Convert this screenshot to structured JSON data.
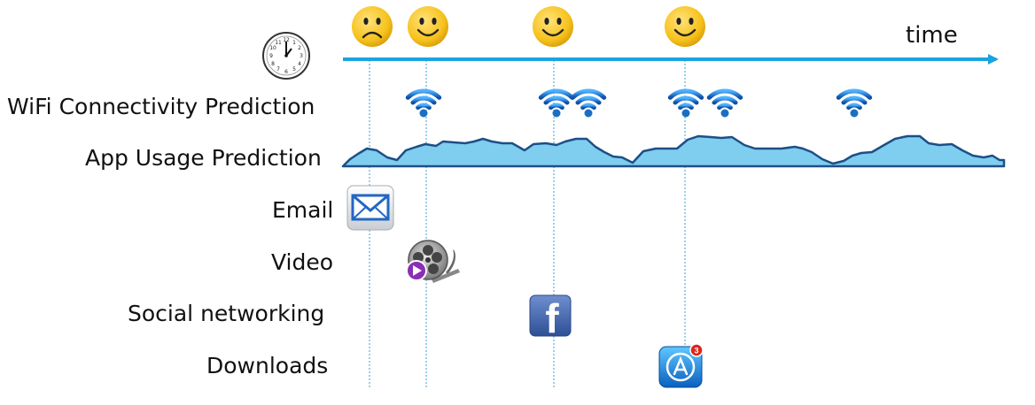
{
  "timeline": {
    "label": "time",
    "icon": "clock-icon",
    "axis_color": "#1aa3e0"
  },
  "rows": [
    {
      "key": "wifi",
      "label": "WiFi Connectivity Prediction",
      "icon": "wifi-icon"
    },
    {
      "key": "app_usage",
      "label": "App Usage Prediction",
      "icon": "usage-curve"
    },
    {
      "key": "email",
      "label": "Email",
      "icon": "email-icon"
    },
    {
      "key": "video",
      "label": "Video",
      "icon": "video-reel-icon"
    },
    {
      "key": "social",
      "label": "Social networking",
      "icon": "facebook-icon"
    },
    {
      "key": "downloads",
      "label": "Downloads",
      "icon": "app-store-icon"
    }
  ],
  "moods": [
    "sad",
    "happy",
    "happy",
    "happy"
  ],
  "app_store_badge": "3",
  "facebook_letter": "f",
  "colors": {
    "axis": "#1aa3e0",
    "curve_fill": "#7fcdef",
    "curve_stroke": "#1d4f86",
    "guide": "#3a9fd6",
    "face": "#f6c21c",
    "wifi": "#1a6fc4"
  }
}
